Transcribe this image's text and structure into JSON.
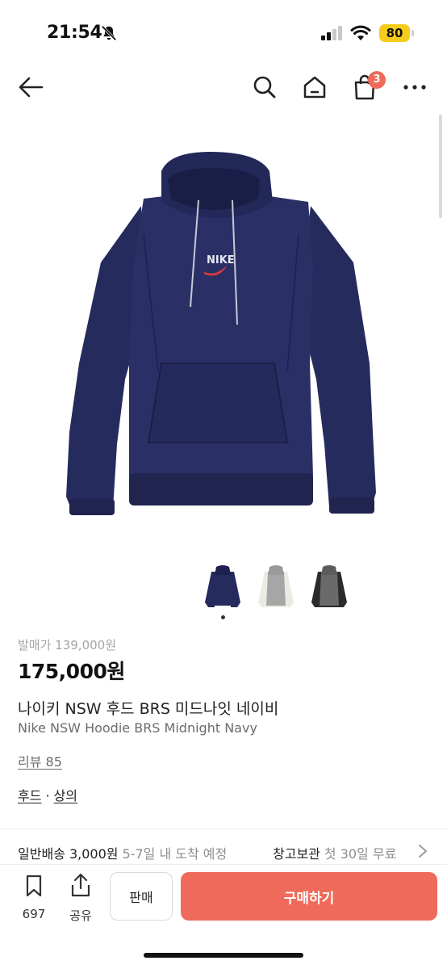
{
  "status_bar": {
    "time": "21:54",
    "battery": "80",
    "icons": [
      "bell-muted-icon",
      "cellular-signal-icon",
      "wifi-icon",
      "battery-icon"
    ]
  },
  "nav": {
    "icons": [
      "back-arrow-icon",
      "search-icon",
      "home-icon",
      "shopping-bag-icon",
      "more-icon"
    ],
    "cart_count": "3"
  },
  "product": {
    "original_price": "발매가 139,000원",
    "price": "175,000원",
    "name_ko": "나이키 NSW 후드 BRS 미드나잇 네이비",
    "name_en": "Nike NSW Hoodie BRS Midnight Navy",
    "reviews": "리뷰 85",
    "categories": [
      "후드",
      "상의"
    ],
    "category_separator": "·",
    "brand_logo_text": "NIKE"
  },
  "shipping": {
    "standard_label": "일반배송 3,000원",
    "standard_eta": "5-7일 내 도착 예정",
    "storage_label": "창고보관",
    "storage_note": "첫 30일 무료"
  },
  "actions": {
    "bookmark_count": "697",
    "share_label": "공유",
    "sell_label": "판매",
    "buy_label": "구매하기"
  },
  "colors": {
    "accent": "#ef6a5a",
    "battery": "#f6cc1c",
    "hoodie_navy": "#23285a"
  }
}
